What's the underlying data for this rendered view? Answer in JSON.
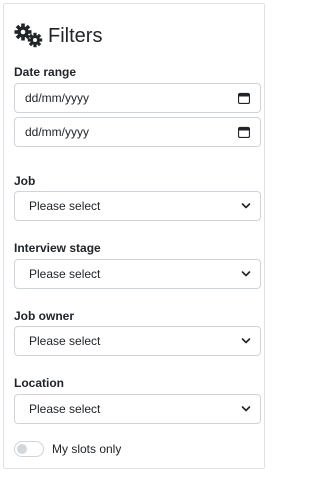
{
  "title": "Filters",
  "title_icon": "gears-icon",
  "date_range": {
    "label": "Date range",
    "from_placeholder": "dd/mm/yyyy",
    "to_placeholder": "dd/mm/yyyy"
  },
  "filters": {
    "job": {
      "label": "Job",
      "value": "Please select"
    },
    "interview_stage": {
      "label": "Interview stage",
      "value": "Please select"
    },
    "job_owner": {
      "label": "Job owner",
      "value": "Please select"
    },
    "location": {
      "label": "Location",
      "value": "Please select"
    }
  },
  "my_slots": {
    "label": "My slots only",
    "checked": false
  }
}
